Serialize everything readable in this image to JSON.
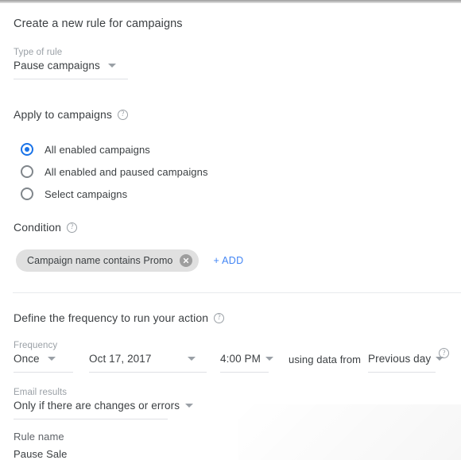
{
  "window": {
    "title": "Create a new rule for campaigns"
  },
  "type_of_rule": {
    "label": "Type of rule",
    "value": "Pause campaigns"
  },
  "apply_to": {
    "heading": "Apply to campaigns",
    "help_glyph": "?",
    "options": [
      {
        "label": "All enabled campaigns",
        "selected": true
      },
      {
        "label": "All enabled and paused campaigns",
        "selected": false
      },
      {
        "label": "Select campaigns",
        "selected": false
      }
    ]
  },
  "condition": {
    "heading": "Condition",
    "help_glyph": "?",
    "chip_label": "Campaign name contains Promo",
    "add_label": "+ ADD"
  },
  "frequency": {
    "heading": "Define the frequency to run your action",
    "help_glyph": "?",
    "frequency_label": "Frequency",
    "frequency_value": "Once",
    "date_value": "Oct 17, 2017",
    "time_value": "4:00 PM",
    "using_data_from_label": "using data from",
    "data_range_value": "Previous day"
  },
  "email": {
    "label": "Email results",
    "value": "Only if there are changes or errors"
  },
  "rule_name": {
    "label": "Rule name",
    "value": "Pause Sale"
  },
  "colors": {
    "accent": "#1a73e8",
    "link": "#4285f4",
    "text": "#3c4043",
    "muted": "#9aa0a6",
    "chip_bg": "#e0e0e0",
    "divider": "#e8eaed"
  }
}
